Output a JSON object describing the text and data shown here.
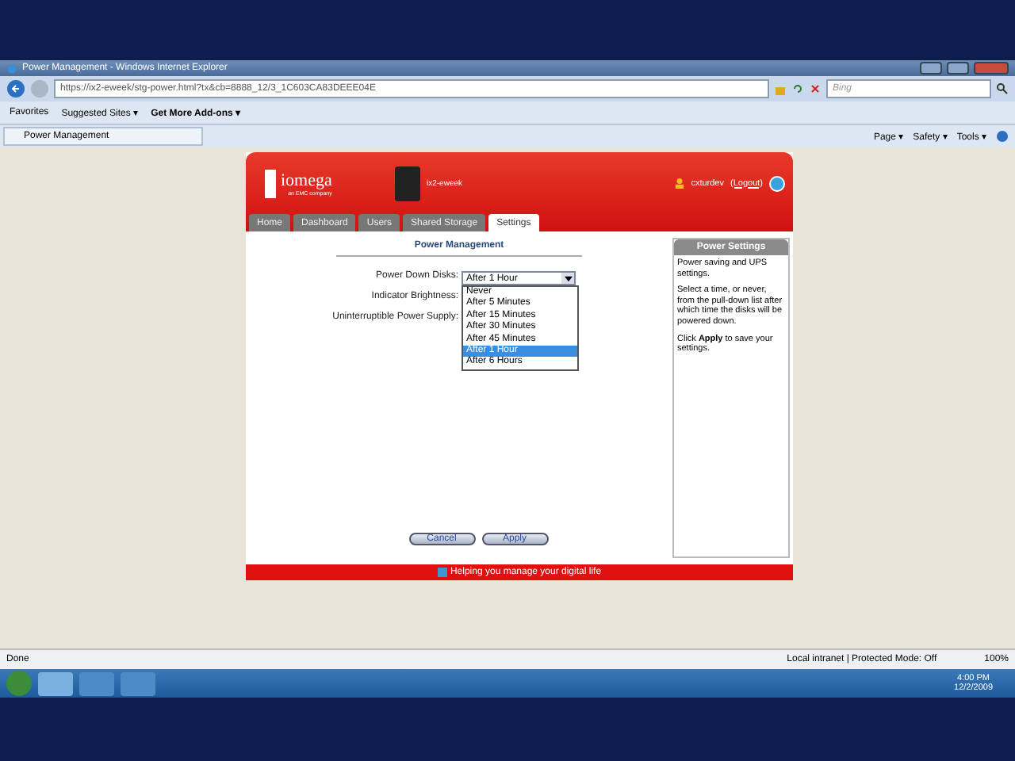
{
  "window": {
    "title": "Power Management - Windows Internet Explorer"
  },
  "address_bar": {
    "value": "https://ix2-eweek/stg-power.html?tx&cb=8888_12/3_1C603CA83DEEE04E",
    "search_placeholder": "Bing"
  },
  "favorites_bar": {
    "items": [
      {
        "label": "Favorites"
      },
      {
        "label": "Suggested Sites ▾"
      },
      {
        "label": "Get More Add-ons ▾"
      }
    ]
  },
  "browser_tab": {
    "label": "Power Management"
  },
  "command_bar": {
    "items": [
      {
        "label": "Page ▾"
      },
      {
        "label": "Safety ▾"
      },
      {
        "label": "Tools ▾"
      }
    ]
  },
  "app_header": {
    "logo": "iomega",
    "logo_subtitle": "an EMC company",
    "device_name": "ix2-eweek",
    "user": "cxturdev",
    "logout": "(Logout)"
  },
  "nav_tabs": [
    {
      "label": "Home",
      "selected": false
    },
    {
      "label": "Dashboard",
      "selected": false
    },
    {
      "label": "Users",
      "selected": false
    },
    {
      "label": "Shared Storage",
      "selected": false
    },
    {
      "label": "Settings",
      "selected": true
    }
  ],
  "page_heading": "Power Management",
  "form": {
    "fields": [
      {
        "label": "Power Down Disks:",
        "value": "After 1 Hour",
        "expanded": true
      },
      {
        "label": "Indicator Brightness:"
      },
      {
        "label": "Uninterruptible Power Supply:"
      }
    ],
    "options": [
      {
        "label": "Never",
        "selected": false
      },
      {
        "label": "After 5 Minutes",
        "selected": false
      },
      {
        "label": "After 15 Minutes",
        "selected": false
      },
      {
        "label": "After 30 Minutes",
        "selected": false
      },
      {
        "label": "After 45 Minutes",
        "selected": false
      },
      {
        "label": "After 1 Hour",
        "selected": true
      },
      {
        "label": "After 6 Hours",
        "selected": false
      }
    ]
  },
  "side_panel": {
    "title": "Power Settings",
    "paragraphs": [
      "Power saving and UPS settings.",
      "Select a time, or never, from the pull-down list after which time the disks will be powered down.",
      "Click **Apply** to save your settings."
    ]
  },
  "buttons": [
    "Cancel",
    "Apply"
  ],
  "footer": "Helping you manage your digital life",
  "status_bar": {
    "status": "Done",
    "zone": "Local intranet | Protected Mode: Off",
    "zoom": "100%"
  },
  "taskbar": {
    "time": "4:00 PM",
    "date": "12/2/2009"
  }
}
